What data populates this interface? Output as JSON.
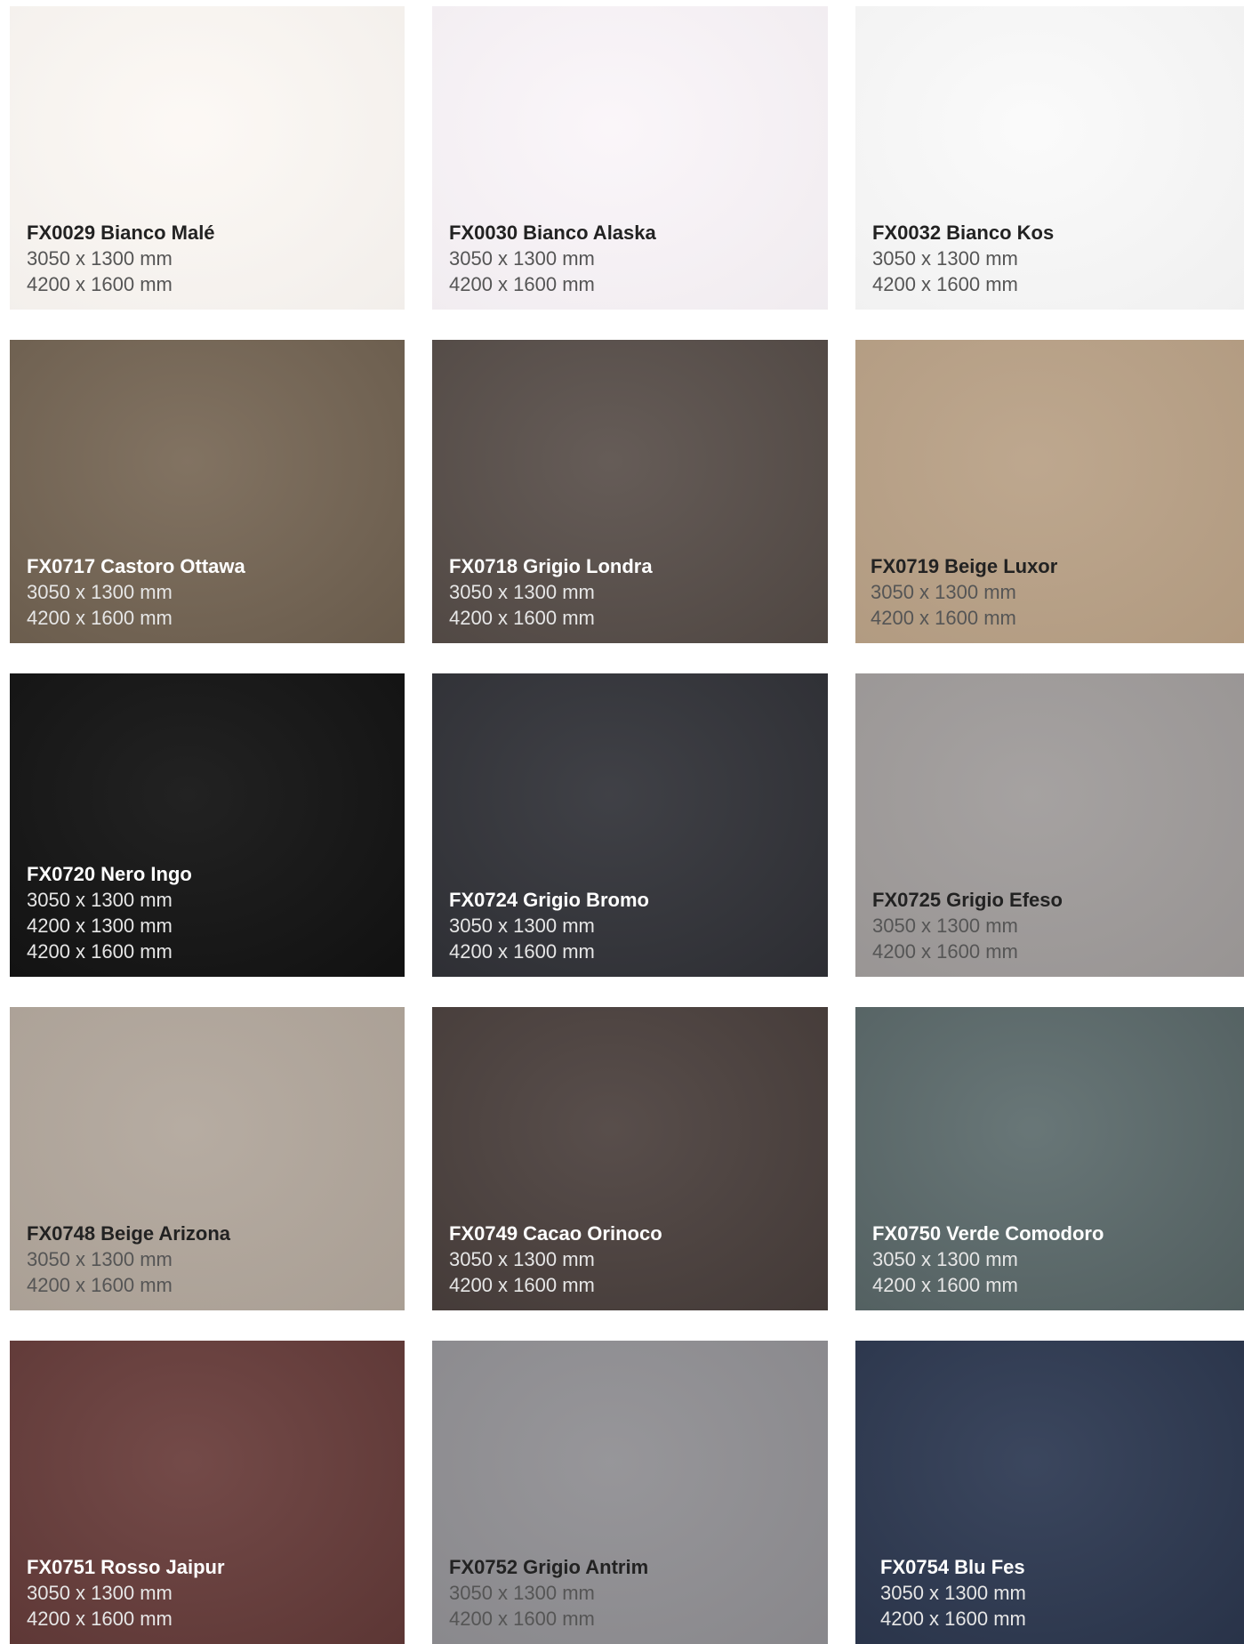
{
  "colors": {
    "page_background": "#ffffff",
    "light_text_title": "#222222",
    "light_text_sizes": "#555555",
    "dark_text_title": "#ffffff",
    "dark_text_sizes": "#e6e6e6"
  },
  "swatches": [
    {
      "name": "FX0029 Bianco Malé",
      "sizes": [
        "3050 x 1300 mm",
        "4200 x 1600 mm"
      ],
      "color": "#fcf8f4",
      "text_theme": "light"
    },
    {
      "name": "FX0030 Bianco Alaska",
      "sizes": [
        "3050 x 1300 mm",
        "4200 x 1600 mm"
      ],
      "color": "#faf5f9",
      "text_theme": "light"
    },
    {
      "name": "FX0032 Bianco Kos",
      "sizes": [
        "3050 x 1300 mm",
        "4200 x 1600 mm"
      ],
      "color": "#fafafa",
      "text_theme": "light"
    },
    {
      "name": "FX0717 Castoro Ottawa",
      "sizes": [
        "3050 x 1300 mm",
        "4200 x 1600 mm"
      ],
      "color": "#7a6a58",
      "text_theme": "dark"
    },
    {
      "name": "FX0718 Grigio Londra",
      "sizes": [
        "3050 x 1300 mm",
        "4200 x 1600 mm"
      ],
      "color": "#5c524d",
      "text_theme": "dark"
    },
    {
      "name": "FX0719 Beige Luxor",
      "sizes": [
        "3050 x 1300 mm",
        "4200 x 1600 mm"
      ],
      "color": "#b8a085",
      "text_theme": "light"
    },
    {
      "name": "FX0720 Nero Ingo",
      "sizes": [
        "3050 x 1300 mm",
        "4200 x 1300 mm",
        "4200 x 1600 mm"
      ],
      "color": "#141414",
      "text_theme": "dark"
    },
    {
      "name": "FX0724 Grigio Bromo",
      "sizes": [
        "3050 x 1300 mm",
        "4200 x 1600 mm"
      ],
      "color": "#34353b",
      "text_theme": "dark"
    },
    {
      "name": "FX0725 Grigio Efeso",
      "sizes": [
        "3050 x 1300 mm",
        "4200 x 1600 mm"
      ],
      "color": "#9e9a99",
      "text_theme": "light"
    },
    {
      "name": "FX0748 Beige Arizona",
      "sizes": [
        "3050 x 1300 mm",
        "4200 x 1600 mm"
      ],
      "color": "#b0a59a",
      "text_theme": "light"
    },
    {
      "name": "FX0749 Cacao Orinoco",
      "sizes": [
        "3050 x 1300 mm",
        "4200 x 1600 mm"
      ],
      "color": "#4e4340",
      "text_theme": "dark"
    },
    {
      "name": "FX0750 Verde Comodoro",
      "sizes": [
        "3050 x 1300 mm",
        "4200 x 1600 mm"
      ],
      "color": "#5f6e6f",
      "text_theme": "dark"
    },
    {
      "name": "FX0751 Rosso Jaipur",
      "sizes": [
        "3050 x 1300 mm",
        "4200 x 1600 mm"
      ],
      "color": "#6b3f3d",
      "text_theme": "dark"
    },
    {
      "name": "FX0752 Grigio Antrim",
      "sizes": [
        "3050 x 1300 mm",
        "4200 x 1600 mm"
      ],
      "color": "#8e8d91",
      "text_theme": "light"
    },
    {
      "name": "FX0754 Blu Fes",
      "sizes": [
        "3050 x 1300 mm",
        "4200 x 1600 mm"
      ],
      "color": "#2f3b54",
      "text_theme": "dark"
    }
  ]
}
